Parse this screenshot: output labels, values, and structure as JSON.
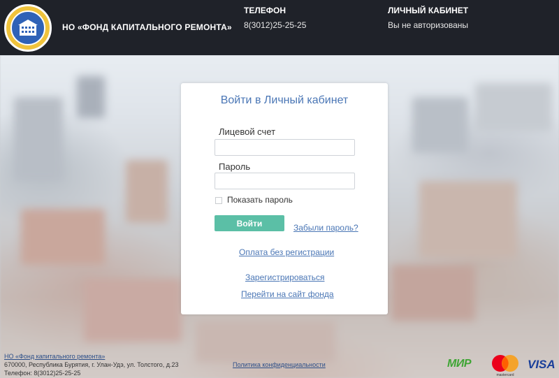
{
  "header": {
    "org_name": "НО «ФОНД КАПИТАЛЬНОГО РЕМОНТА»",
    "phone_title": "ТЕЛЕФОН",
    "phone_value": "8(3012)25-25-25",
    "cabinet_title": "ЛИЧНЫЙ КАБИНЕТ",
    "cabinet_status": "Вы не авторизованы",
    "logo_icon": "building-emblem-icon"
  },
  "login": {
    "title": "Войти в Личный кабинет",
    "account_label": "Лицевой счет",
    "account_value": "",
    "password_label": "Пароль",
    "password_value": "",
    "show_password_label": "Показать пароль",
    "show_password_checked": false,
    "login_button": "Войти",
    "forgot_link": "Забыли пароль?",
    "pay_without_reg_link": "Оплата без регистрации",
    "register_link": "Зарегистрироваться",
    "go_to_site_link": "Перейти на сайт фонда"
  },
  "footer": {
    "org_link": "НО «Фонд капитального ремонта»",
    "address": "670000, Республика Бурятия, г. Улан-Удэ, ул. Толстого, д.23",
    "phone": "Телефон: 8(3012)25-25-25",
    "privacy_link": "Политика конфиденциальности",
    "payment_mir": "МИР",
    "payment_mastercard": "mastercard",
    "payment_visa": "VISA"
  },
  "colors": {
    "header_bg": "#1f2229",
    "accent_blue": "#4a76b5",
    "login_button_bg": "#5bbfa6"
  }
}
